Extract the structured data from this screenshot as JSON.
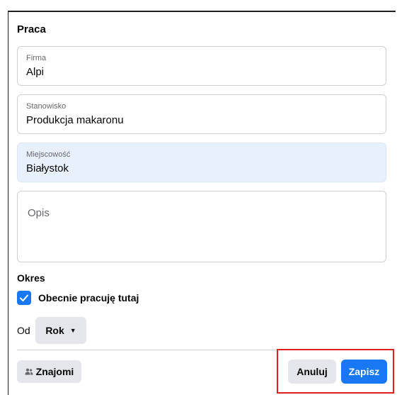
{
  "section_title": "Praca",
  "fields": {
    "company": {
      "label": "Firma",
      "value": "Alpi"
    },
    "position": {
      "label": "Stanowisko",
      "value": "Produkcja makaronu"
    },
    "city": {
      "label": "Miejscowość",
      "value": "Białystok"
    },
    "description": {
      "placeholder": "Opis",
      "value": ""
    }
  },
  "period": {
    "title": "Okres",
    "current_job": {
      "label": "Obecnie pracuję tutaj",
      "checked": true
    },
    "from_label": "Od",
    "year_select": "Rok"
  },
  "footer": {
    "audience_button": "Znajomi",
    "cancel_button": "Anuluj",
    "save_button": "Zapisz"
  },
  "colors": {
    "primary": "#1877f2",
    "focused_field": "#e7f0fd",
    "button_grey": "#e4e6eb",
    "highlight": "#e01e1e"
  },
  "icons": {
    "checkbox": "checkmark-icon",
    "dropdown": "caret-down-icon",
    "audience": "friends-icon"
  }
}
